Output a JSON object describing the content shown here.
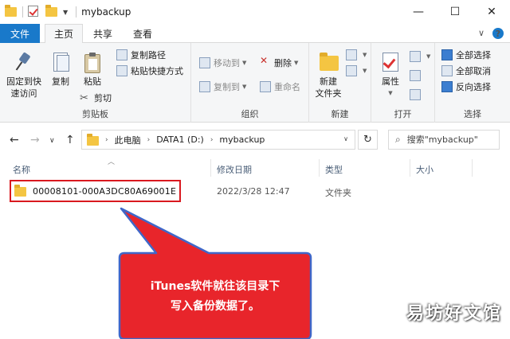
{
  "window": {
    "title": "mybackup",
    "minimize": "—",
    "maximize": "☐",
    "close": "✕"
  },
  "tabs": {
    "file": "文件",
    "home": "主页",
    "share": "共享",
    "view": "查看",
    "collapse": "∨",
    "help": "?"
  },
  "ribbon": {
    "clipboard": {
      "label": "剪贴板",
      "pin": [
        "固定到快",
        "速访问"
      ],
      "copy": "复制",
      "paste": "粘贴",
      "copy_path": "复制路径",
      "paste_shortcut": "粘贴快捷方式",
      "cut": "剪切"
    },
    "organize": {
      "label": "组织",
      "move_to": "移动到",
      "copy_to": "复制到",
      "delete": "删除",
      "rename": "重命名"
    },
    "new": {
      "label": "新建",
      "new_folder": [
        "新建",
        "文件夹"
      ]
    },
    "open": {
      "label": "打开",
      "properties": "属性"
    },
    "select": {
      "label": "选择",
      "select_all": "全部选择",
      "select_none": "全部取消",
      "invert": "反向选择"
    }
  },
  "address": {
    "crumbs": [
      "此电脑",
      "DATA1 (D:)",
      "mybackup"
    ],
    "search_placeholder": "搜索\"mybackup\""
  },
  "columns": {
    "name": "名称",
    "modified": "修改日期",
    "type": "类型",
    "size": "大小"
  },
  "files": [
    {
      "name": "00008101-000A3DC80A69001E",
      "modified": "2022/3/28 12:47",
      "type": "文件夹"
    }
  ],
  "annotation": {
    "line1": "iTunes软件就往该目录下",
    "line2": "写入备份数据了。",
    "fill_color": "#e8252b",
    "border_color": "#3f67c9"
  },
  "watermark": "易坊好文馆"
}
